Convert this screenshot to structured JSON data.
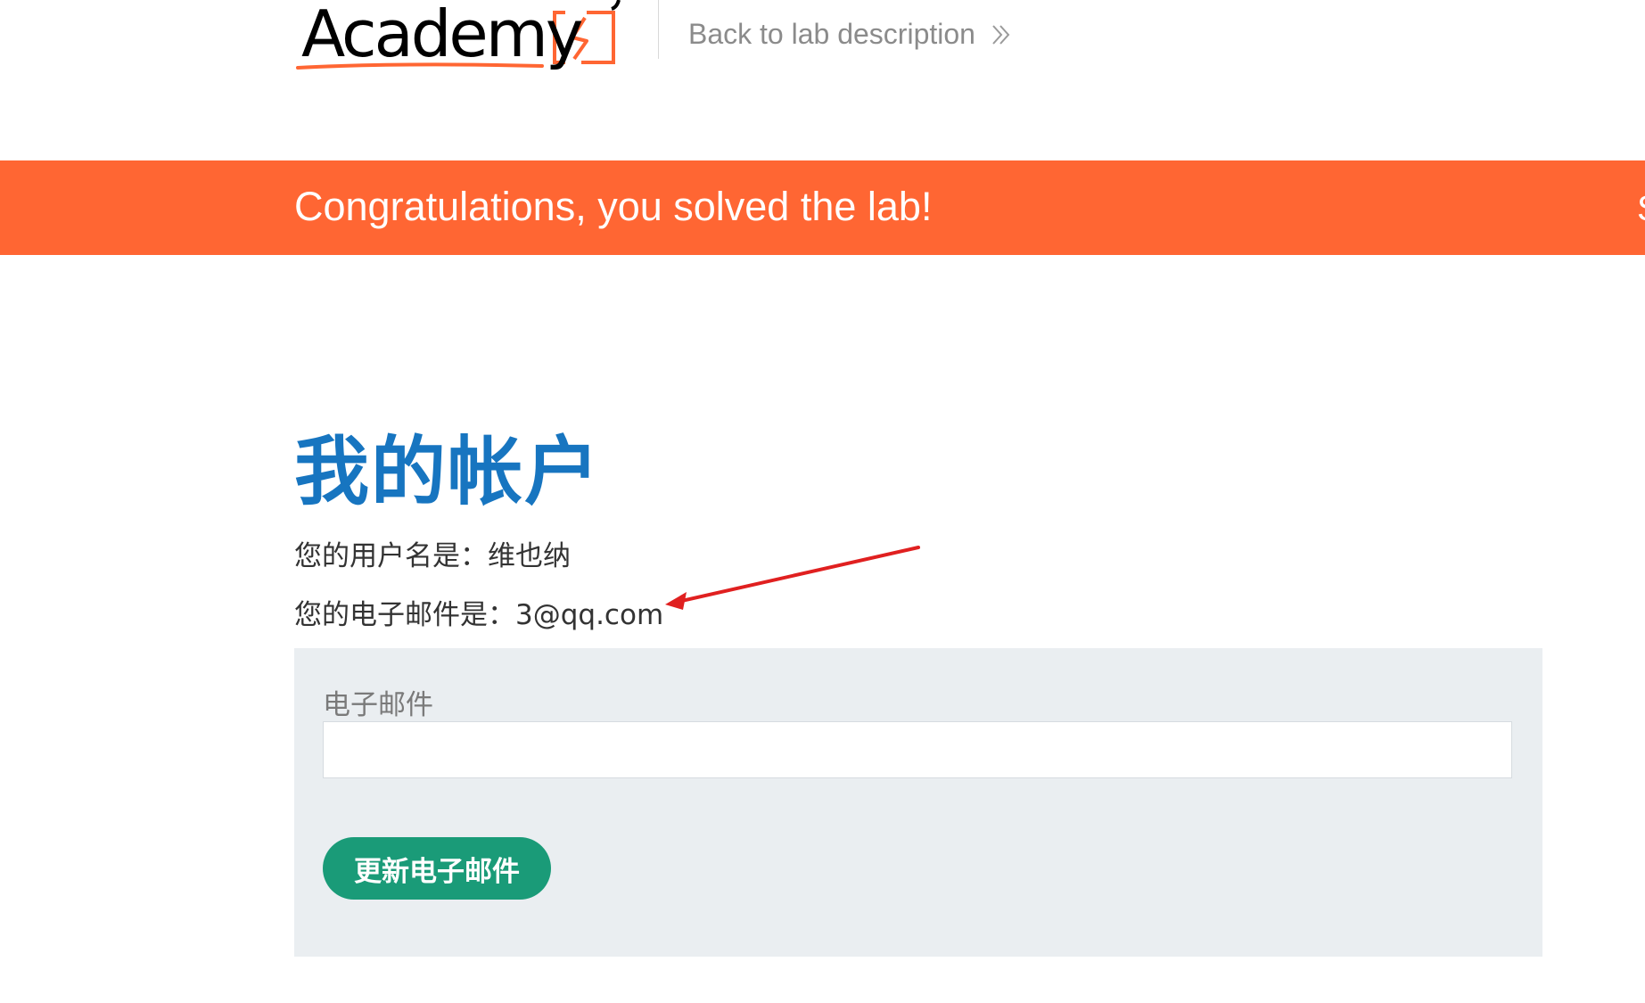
{
  "header": {
    "logo_text": "Academy",
    "back_link_label": "Back to lab description"
  },
  "banner": {
    "message": "Congratulations, you solved the lab!",
    "cut_text": "S"
  },
  "account": {
    "title": "我的帐户",
    "username_line": "您的用户名是：维也纳",
    "email_line": "您的电子邮件是：3@qq.com"
  },
  "form": {
    "email_label": "电子邮件",
    "email_value": "",
    "submit_label": "更新电子邮件"
  },
  "colors": {
    "brand_orange": "#ff6633",
    "title_blue": "#1775c0",
    "button_green": "#1a9b78",
    "panel_bg": "#eaeef1",
    "annotation_red": "#e02020"
  },
  "icons": {
    "back_link_icon": "double-chevron-right-icon",
    "annotation": "red-arrow-icon"
  }
}
